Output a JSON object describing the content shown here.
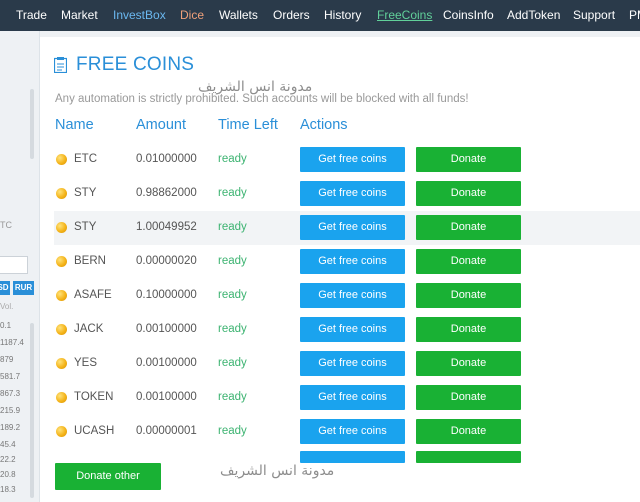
{
  "nav": {
    "items": [
      "Trade",
      "Market",
      "InvestBox",
      "Dice",
      "Wallets",
      "Orders",
      "History",
      "FreeCoins",
      "CoinsInfo",
      "AddToken",
      "Support",
      "PM"
    ]
  },
  "sidebar": {
    "values_top": [
      "0.1",
      "1187.4",
      "879",
      "581.7",
      "867.3",
      "215.9",
      "189.2",
      "45.4",
      "22.2",
      "20.8",
      "18.3"
    ],
    "coin_label": "TC",
    "tabs": [
      "SD",
      "RUR"
    ],
    "vol_label": "Vol."
  },
  "page": {
    "title": "FREE COINS",
    "warning": "Any automation is strictly prohibited. Such accounts will be blocked with all funds!",
    "watermark": "مدونة انس الشريف"
  },
  "table": {
    "headers": {
      "name": "Name",
      "amount": "Amount",
      "time_left": "Time Left",
      "actions": "Actions"
    },
    "rows": [
      {
        "name": "ETC",
        "amount": "0.01000000",
        "status": "ready"
      },
      {
        "name": "STY",
        "amount": "0.98862000",
        "status": "ready"
      },
      {
        "name": "STY",
        "amount": "1.00049952",
        "status": "ready"
      },
      {
        "name": "BERN",
        "amount": "0.00000020",
        "status": "ready"
      },
      {
        "name": "ASAFE",
        "amount": "0.10000000",
        "status": "ready"
      },
      {
        "name": "JACK",
        "amount": "0.00100000",
        "status": "ready"
      },
      {
        "name": "YES",
        "amount": "0.00100000",
        "status": "ready"
      },
      {
        "name": "TOKEN",
        "amount": "0.00100000",
        "status": "ready"
      },
      {
        "name": "UCASH",
        "amount": "0.00000001",
        "status": "ready"
      }
    ],
    "get_free_label": "Get free coins",
    "donate_label": "Donate"
  },
  "donate_other_label": "Donate other",
  "colors": {
    "nav_bg": "#2a3a4a",
    "accent_blue": "#2a8fd8",
    "button_blue": "#1aa3ee",
    "button_green": "#19b134",
    "ready_green": "#3cb371"
  }
}
